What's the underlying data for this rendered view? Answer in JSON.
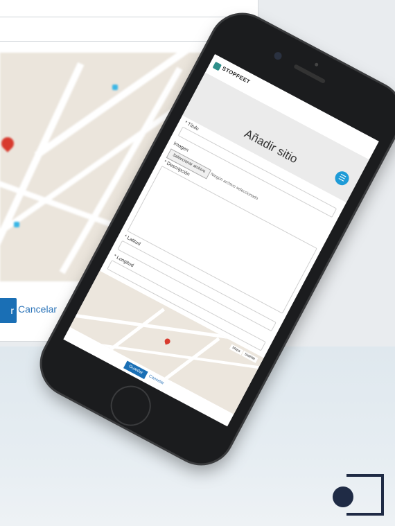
{
  "background_form": {
    "save_label": "r",
    "cancel_label": "Cancelar"
  },
  "phone": {
    "brand": "STOPFEET",
    "page_title": "Añadir sitio",
    "menu_icon": "hamburger-icon",
    "form": {
      "title_label": "* Título",
      "image_label": "Imagen",
      "file_button": "Seleccionar archivo",
      "file_none": "Ningún archivo seleccionado",
      "description_label": "* Descripción",
      "latitude_label": "* Latitud",
      "longitude_label": "* Longitud",
      "map_type_map": "Mapa",
      "map_type_sat": "Satélite"
    },
    "save_label": "Guardar",
    "cancel_label": "Cancelar"
  },
  "colors": {
    "primary": "#1a6fb5",
    "accent": "#1e9bd7",
    "pin": "#d83a2e",
    "brand_dark": "#1f2b45"
  }
}
